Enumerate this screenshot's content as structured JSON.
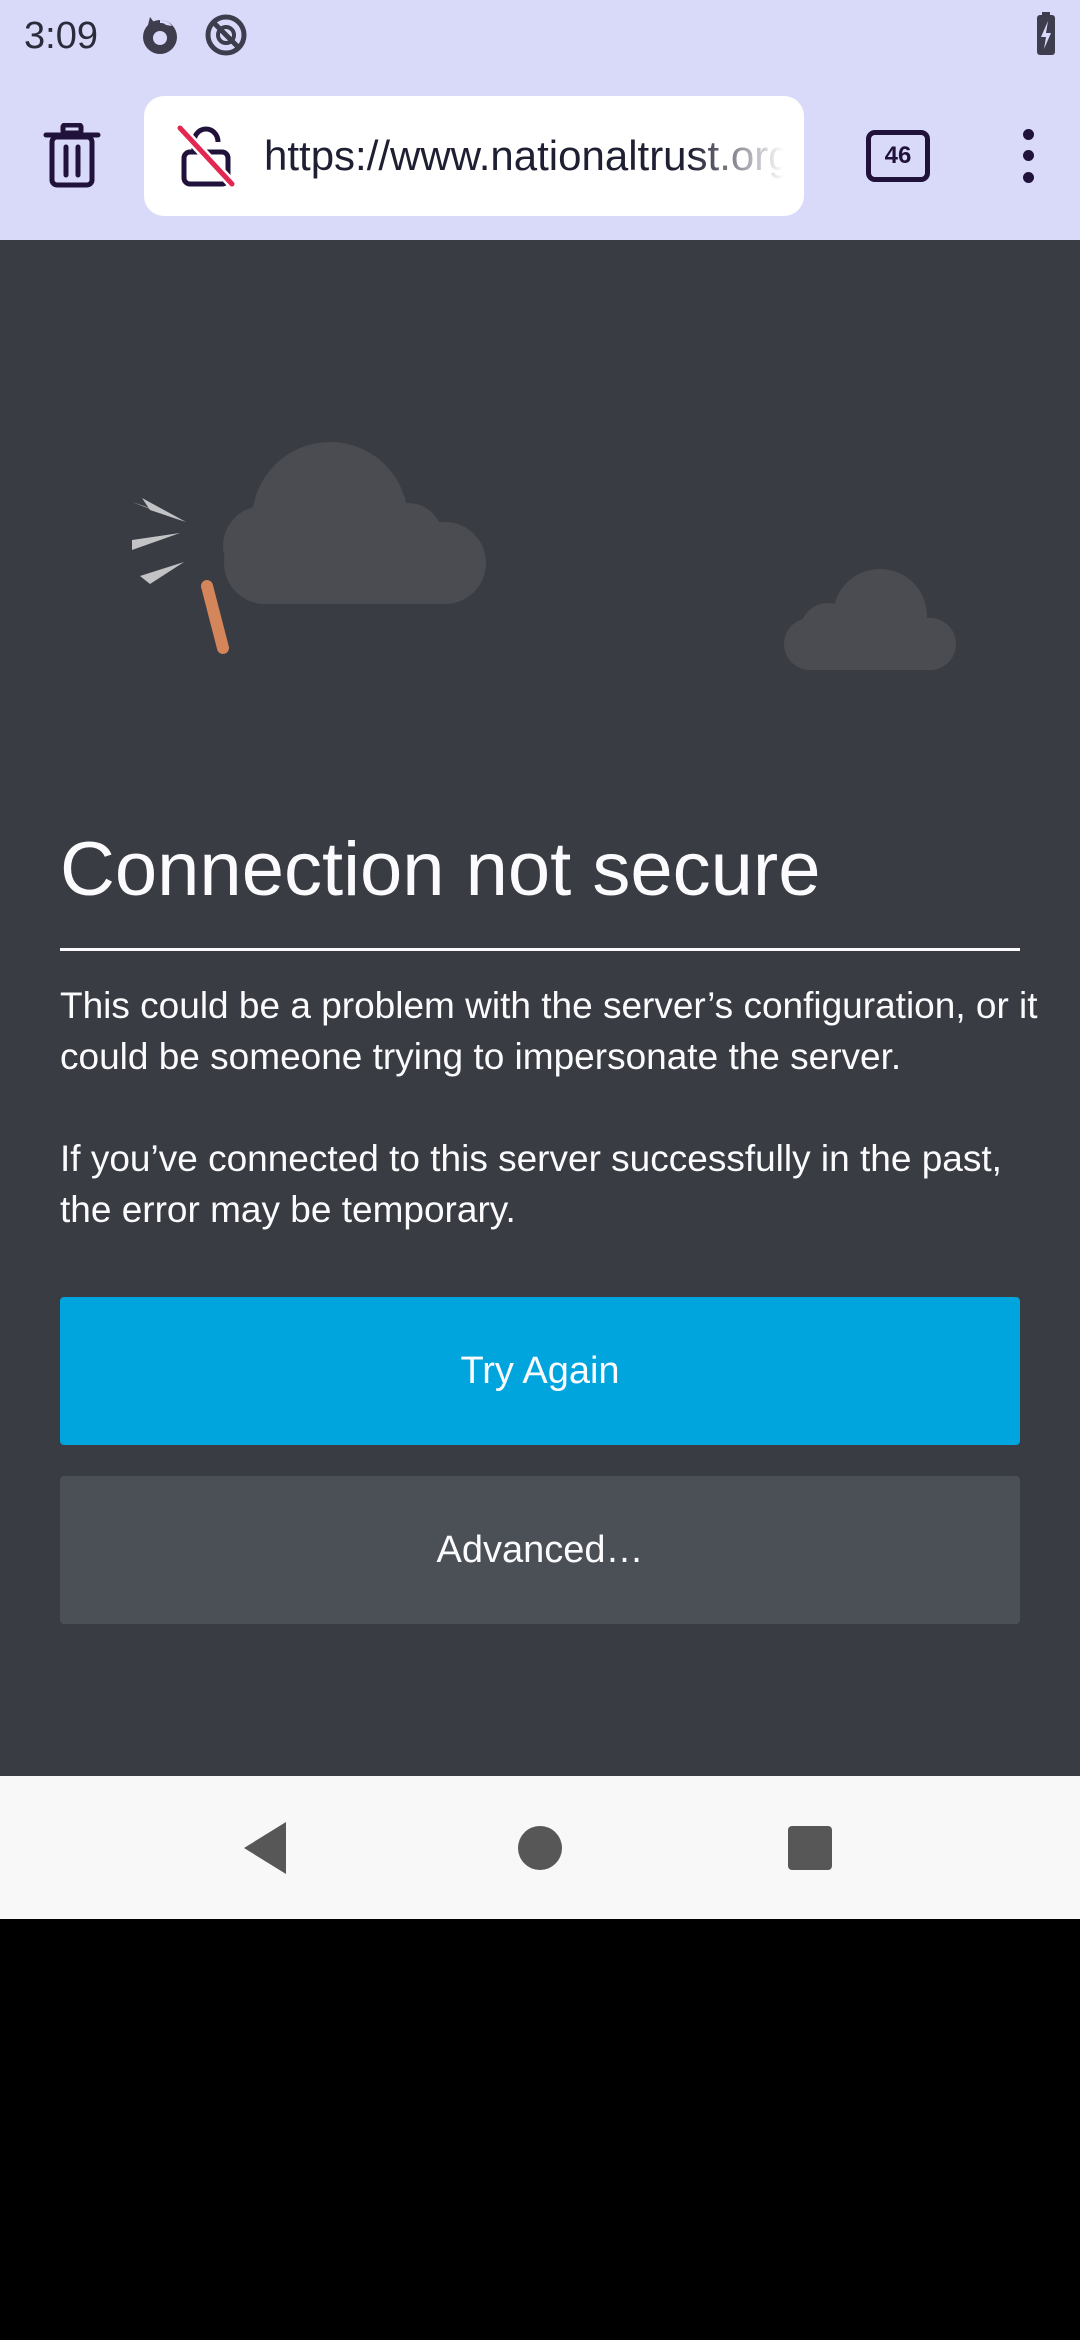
{
  "status_bar": {
    "time": "3:09",
    "icons": [
      "firefox-sync-icon",
      "do-not-disturb-icon",
      "battery-charging-icon"
    ]
  },
  "toolbar": {
    "url": "https://www.nationaltrust.org.uk",
    "tabs_count": "46",
    "icons": [
      "delete-tab-icon",
      "insecure-lock-icon",
      "tabs-counter-icon",
      "overflow-menu-icon"
    ]
  },
  "error_page": {
    "title": "Connection not secure",
    "description_1": "This could be a problem with the server’s configuration, or it could be someone trying to impersonate the server.",
    "description_2": "If you’ve connected to this server successfully in the past, the error may be temporary.",
    "try_again_label": "Try Again",
    "advanced_label": "Advanced…"
  },
  "nav_bar": {
    "icons": [
      "back-icon",
      "home-icon",
      "recents-icon"
    ]
  },
  "colors": {
    "chrome_bg": "#d9d9fa",
    "page_bg": "#393c42",
    "primary_button": "#00a5de",
    "secondary_button": "#4b4f56",
    "plug_accent": "#d4865a"
  }
}
